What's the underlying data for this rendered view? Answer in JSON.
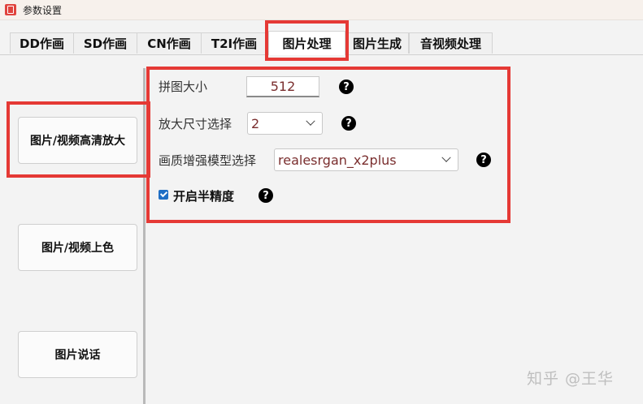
{
  "window": {
    "title": "参数设置"
  },
  "tabs": [
    {
      "label": "DD作画"
    },
    {
      "label": "SD作画"
    },
    {
      "label": "CN作画"
    },
    {
      "label": "T2I作画"
    },
    {
      "label": "图片处理",
      "active": true
    },
    {
      "label": "图片生成"
    },
    {
      "label": "音视频处理"
    }
  ],
  "sidebar": {
    "buttons": [
      {
        "label": "图片/视频高清放大",
        "selected": true
      },
      {
        "label": "图片/视频上色"
      },
      {
        "label": "图片说话"
      }
    ]
  },
  "form": {
    "tile_size": {
      "label": "拼图大小",
      "value": "512",
      "help": "?"
    },
    "upscale": {
      "label": "放大尺寸选择",
      "value": "2",
      "help": "?"
    },
    "model": {
      "label": "画质增强模型选择",
      "value": "realesrgan_x2plus",
      "help": "?"
    },
    "half_precision": {
      "label": "开启半精度",
      "checked": true,
      "help": "?"
    }
  },
  "watermark": "知乎 @王华",
  "colors": {
    "highlight": "#e53935",
    "checkbox": "#1f6fc5",
    "value_text": "#7a2e2e"
  }
}
